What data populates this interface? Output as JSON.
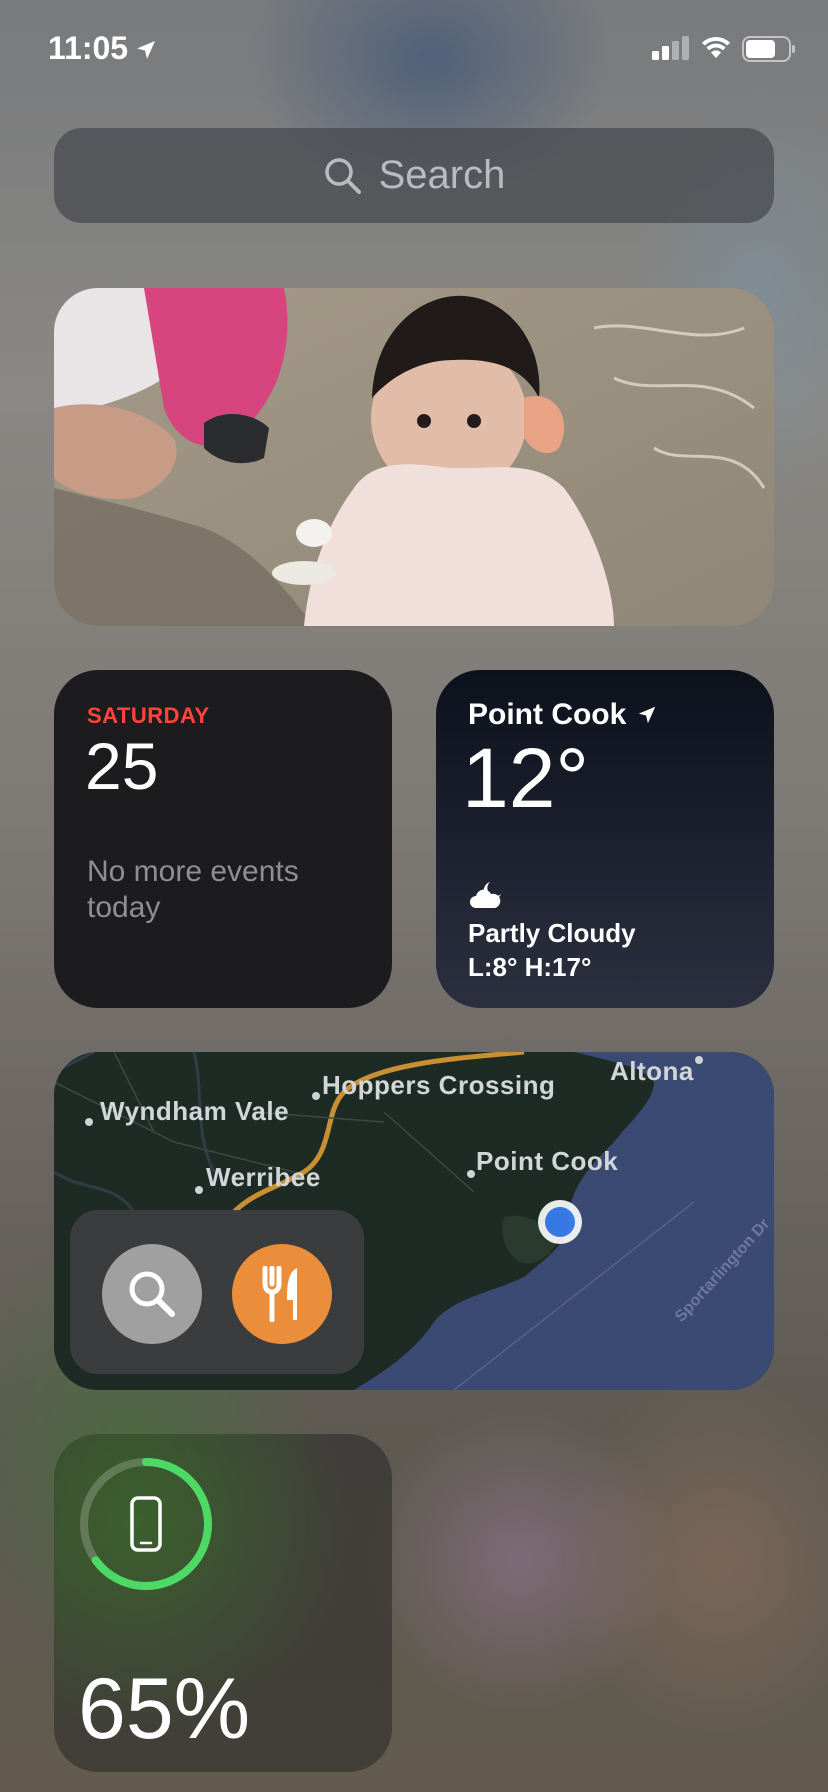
{
  "status_bar": {
    "time": "11:05"
  },
  "search": {
    "placeholder": "Search"
  },
  "calendar": {
    "weekday": "SATURDAY",
    "date": "25",
    "note": "No more events today"
  },
  "weather": {
    "city": "Point Cook",
    "temperature": "12°",
    "condition": "Partly Cloudy",
    "range": "L:8° H:17°",
    "condition_icon": "partly-cloudy-night-icon"
  },
  "maps": {
    "labels": {
      "wyndham_vale": "Wyndham Vale",
      "hoppers_crossing": "Hoppers Crossing",
      "altona": "Altona",
      "werribee": "Werribee",
      "point_cook": "Point Cook",
      "road": "Sportarlington Dr"
    },
    "buttons": {
      "search_icon": "magnifier-icon",
      "food_icon": "fork-knife-icon"
    }
  },
  "battery": {
    "level": 0.65,
    "label": "65%"
  },
  "colors": {
    "calendar_accent": "#ff453a",
    "battery_ring": "#4cd964",
    "maps_food": "#ea8e3b",
    "location_dot": "#3a82f7"
  }
}
